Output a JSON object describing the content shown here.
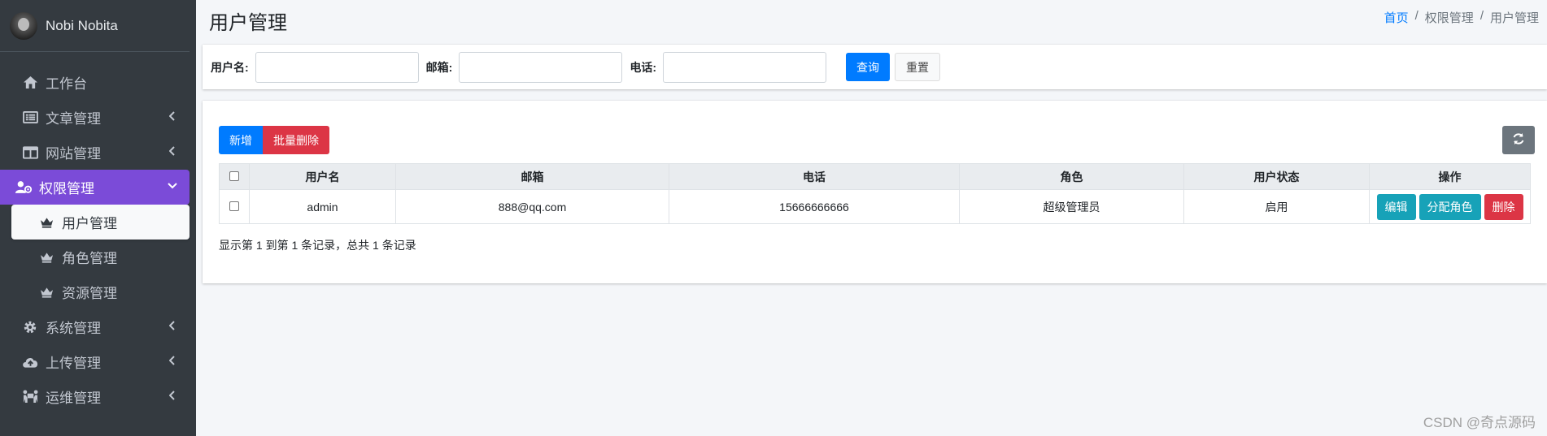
{
  "sidebar": {
    "user_name": "Nobi Nobita",
    "items": [
      {
        "label": "工作台"
      },
      {
        "label": "文章管理"
      },
      {
        "label": "网站管理"
      },
      {
        "label": "权限管理"
      },
      {
        "label": "系统管理"
      },
      {
        "label": "上传管理"
      },
      {
        "label": "运维管理"
      }
    ],
    "sub_items": [
      {
        "label": "用户管理"
      },
      {
        "label": "角色管理"
      },
      {
        "label": "资源管理"
      }
    ],
    "active_color": "#7b4bd8"
  },
  "header": {
    "title": "用户管理",
    "breadcrumb": [
      "首页",
      "权限管理",
      "用户管理"
    ],
    "separator": "/"
  },
  "search": {
    "username_label": "用户名:",
    "email_label": "邮箱:",
    "phone_label": "电话:",
    "query_label": "查询",
    "reset_label": "重置"
  },
  "toolbar": {
    "add_label": "新增",
    "batch_delete_label": "批量删除"
  },
  "table": {
    "columns": [
      "用户名",
      "邮箱",
      "电话",
      "角色",
      "用户状态",
      "操作"
    ],
    "rows": [
      {
        "username": "admin",
        "email": "888@qq.com",
        "phone": "15666666666",
        "role": "超级管理员",
        "status": "启用"
      }
    ],
    "actions": {
      "edit": "编辑",
      "assign_role": "分配角色",
      "delete": "删除"
    },
    "summary": "显示第 1 到第 1 条记录，总共 1 条记录"
  },
  "watermark": "CSDN @奇点源码"
}
